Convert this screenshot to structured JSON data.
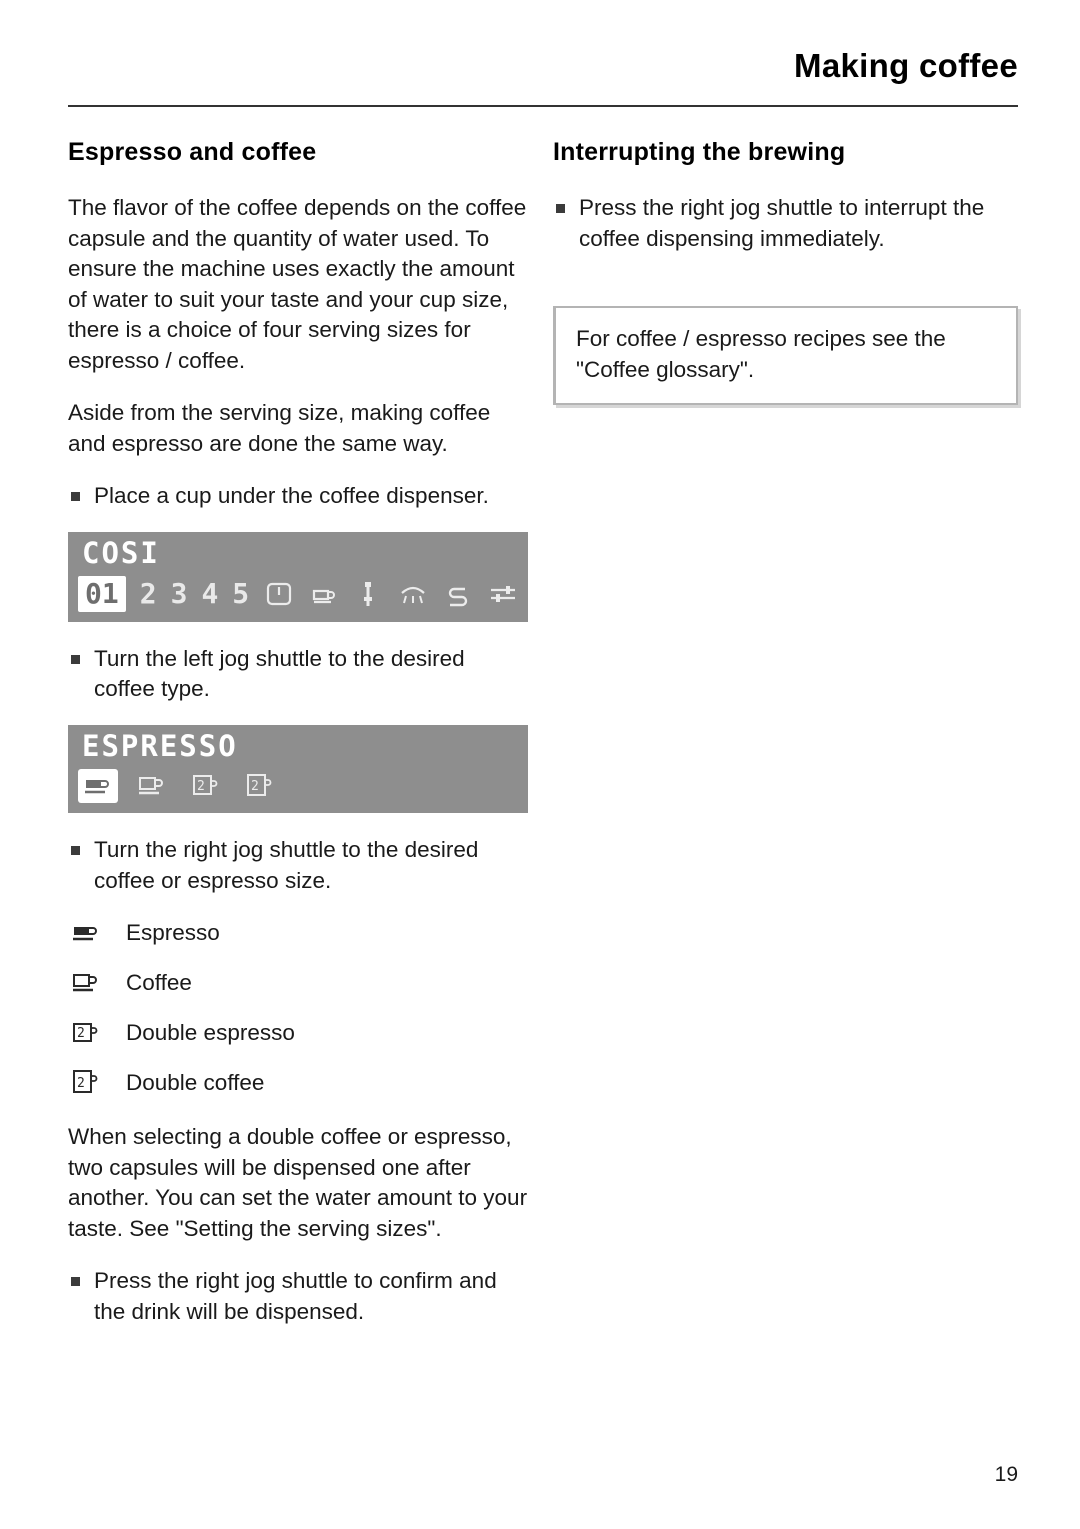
{
  "header": {
    "title": "Making coffee"
  },
  "left": {
    "section_title": "Espresso and coffee",
    "para1": "The flavor of the coffee depends on the coffee capsule and the quantity of water used. To ensure the machine uses exactly the amount of water to suit your taste and your cup size, there is a choice of four serving sizes for espresso / coffee.",
    "para2": "Aside from the serving size, making coffee and espresso are done the same way.",
    "bullet1": "Place a cup under the coffee dispenser.",
    "display1": {
      "title": "COSI",
      "items": [
        "01",
        "2",
        "3",
        "4",
        "5"
      ],
      "selected_index": 0,
      "icons": [
        "power-icon",
        "cup-icon",
        "steam-wand-icon",
        "rinse-icon",
        "water-flow-icon",
        "settings-slider-icon"
      ]
    },
    "bullet2": "Turn the left jog shuttle to the desired coffee type.",
    "display2": {
      "title": "ESPRESSO",
      "icons": [
        "espresso-cup-icon",
        "coffee-cup-icon",
        "double-espresso-icon",
        "double-coffee-icon"
      ],
      "selected_index": 0
    },
    "bullet3": "Turn the right jog shuttle to the desired coffee or espresso size.",
    "legend": [
      {
        "icon": "espresso-cup-icon",
        "label": "Espresso"
      },
      {
        "icon": "coffee-cup-icon",
        "label": "Coffee"
      },
      {
        "icon": "double-espresso-icon",
        "label": "Double espresso"
      },
      {
        "icon": "double-coffee-icon",
        "label": "Double coffee"
      }
    ],
    "para3": "When selecting a double coffee or espresso, two capsules will be dispensed one after another. You can set the water amount to your taste. See \"Setting the serving sizes\".",
    "bullet4": "Press the right jog shuttle to confirm and the drink will be dispensed."
  },
  "right": {
    "section_title": "Interrupting the brewing",
    "bullet1": "Press the right jog shuttle to interrupt the coffee dispensing immediately.",
    "note": "For coffee / espresso recipes see the \"Coffee glossary\"."
  },
  "footer": {
    "page_number": "19"
  }
}
